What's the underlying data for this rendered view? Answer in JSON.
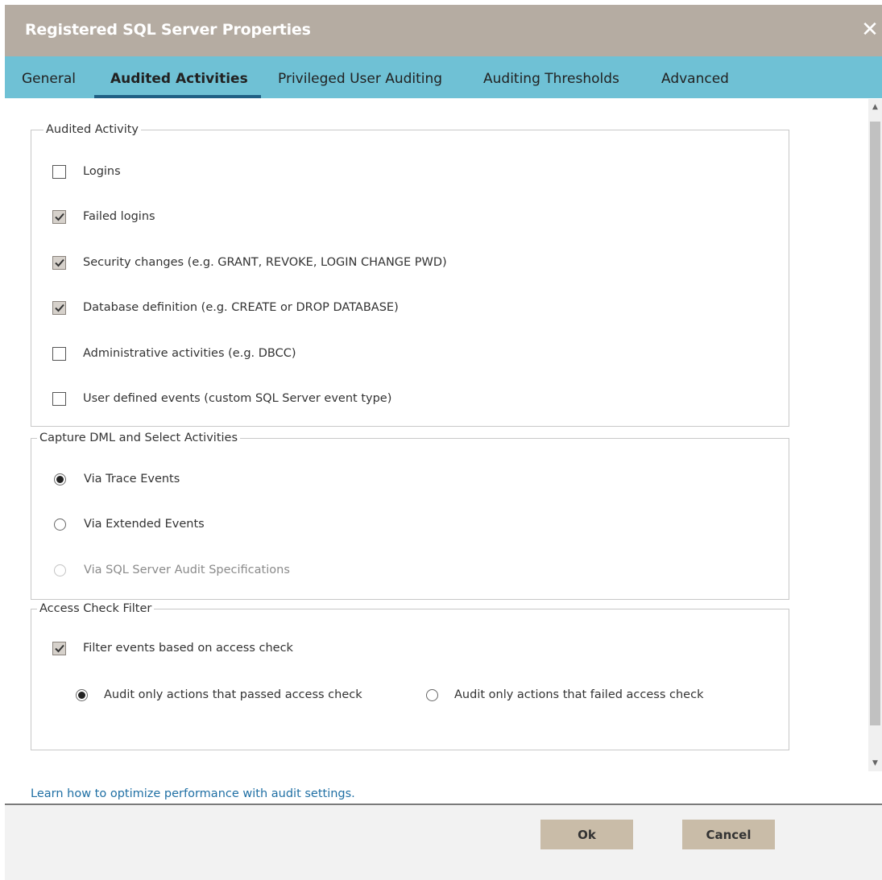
{
  "dialog": {
    "title": "Registered SQL Server Properties",
    "close_icon": "close-icon",
    "accent_colors": {
      "titlebar": "#b5aca2",
      "tabbar": "#6fc1d5",
      "active_tab_underline": "#1f5f84",
      "button": "#c9bca8",
      "link": "#1f6fa4"
    }
  },
  "tabs": [
    {
      "label": "General",
      "active": false
    },
    {
      "label": "Audited Activities",
      "active": true
    },
    {
      "label": "Privileged User Auditing",
      "active": false
    },
    {
      "label": "Auditing Thresholds",
      "active": false
    },
    {
      "label": "Advanced",
      "active": false
    }
  ],
  "audited_activity": {
    "legend": "Audited Activity",
    "items": [
      {
        "label": "Logins",
        "checked": false
      },
      {
        "label": "Failed logins",
        "checked": true
      },
      {
        "label": "Security changes (e.g. GRANT, REVOKE, LOGIN CHANGE PWD)",
        "checked": true
      },
      {
        "label": "Database definition (e.g. CREATE or DROP DATABASE)",
        "checked": true
      },
      {
        "label": "Administrative activities (e.g. DBCC)",
        "checked": false
      },
      {
        "label": "User defined events (custom SQL Server event type)",
        "checked": false
      }
    ]
  },
  "capture_dml": {
    "legend": "Capture DML and Select Activities",
    "options": [
      {
        "label": "Via Trace Events",
        "selected": true,
        "disabled": false
      },
      {
        "label": "Via Extended Events",
        "selected": false,
        "disabled": false
      },
      {
        "label": "Via SQL Server Audit Specifications",
        "selected": false,
        "disabled": true
      }
    ]
  },
  "access_check": {
    "legend": "Access Check Filter",
    "filter_label": "Filter events based on access check",
    "filter_checked": true,
    "options": [
      {
        "label": "Audit only actions that passed access check",
        "selected": true
      },
      {
        "label": "Audit only actions that failed access check",
        "selected": false
      }
    ]
  },
  "help_link": "Learn how to optimize performance with audit settings.",
  "buttons": {
    "ok": "Ok",
    "cancel": "Cancel"
  }
}
